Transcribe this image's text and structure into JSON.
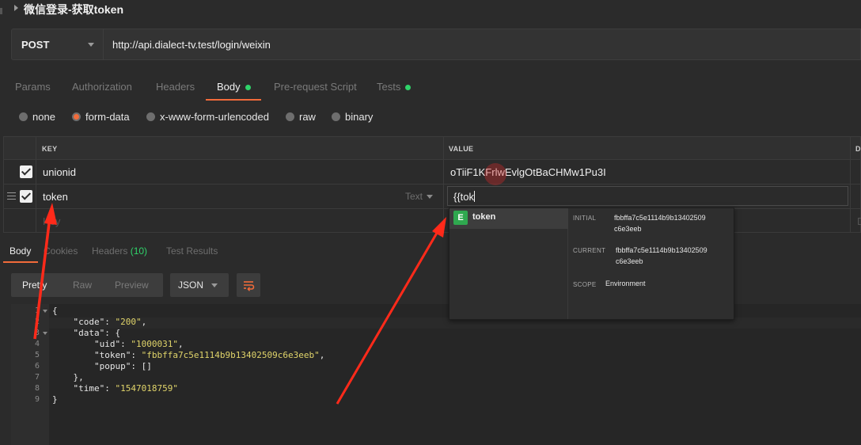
{
  "request": {
    "title": "微信登录-获取token",
    "method": "POST",
    "url": "http://api.dialect-tv.test/login/weixin"
  },
  "request_tabs": [
    {
      "label": "Params",
      "active": false
    },
    {
      "label": "Authorization",
      "active": false
    },
    {
      "label": "Headers",
      "active": false
    },
    {
      "label": "Body",
      "active": true,
      "dot": true
    },
    {
      "label": "Pre-request Script",
      "active": false
    },
    {
      "label": "Tests",
      "active": false,
      "dot": true
    }
  ],
  "body_types": [
    {
      "label": "none",
      "selected": false
    },
    {
      "label": "form-data",
      "selected": true
    },
    {
      "label": "x-www-form-urlencoded",
      "selected": false
    },
    {
      "label": "raw",
      "selected": false
    },
    {
      "label": "binary",
      "selected": false
    }
  ],
  "form_table": {
    "headers": {
      "key": "KEY",
      "value": "VALUE",
      "description": "D"
    },
    "rows": [
      {
        "checked": true,
        "key": "unionid",
        "value": "oTiiF1KFrlwEvlgOtBaCHMw1Pu3I"
      },
      {
        "checked": true,
        "key": "token",
        "type": "Text",
        "value": "{{tok"
      }
    ],
    "empty_row": {
      "key_placeholder": "Key",
      "desc_placeholder": "D"
    }
  },
  "response_tabs": [
    {
      "label": "Body",
      "active": true
    },
    {
      "label": "Cookies",
      "active": false
    },
    {
      "label": "Headers",
      "active": false,
      "count": "(10)"
    },
    {
      "label": "Test Results",
      "active": false
    }
  ],
  "view_modes": [
    "Pretty",
    "Raw",
    "Preview"
  ],
  "format": "JSON",
  "response_lines": [
    {
      "n": "1",
      "text": "{"
    },
    {
      "n": "2",
      "text": "    \"code\": \"200\","
    },
    {
      "n": "3",
      "text": "    \"data\": {"
    },
    {
      "n": "4",
      "text": "        \"uid\": \"1000031\","
    },
    {
      "n": "5",
      "text": "        \"token\": \"fbbffa7c5e1114b9b13402509c6e3eeb\","
    },
    {
      "n": "6",
      "text": "        \"popup\": []"
    },
    {
      "n": "7",
      "text": "    },"
    },
    {
      "n": "8",
      "text": "    \"time\": \"1547018759\""
    },
    {
      "n": "9",
      "text": "}"
    }
  ],
  "autocomplete": {
    "badge": "E",
    "name": "token",
    "initial_label": "INITIAL",
    "initial_value": "fbbffa7c5e1114b9b13402509c6e3eeb",
    "current_label": "CURRENT",
    "current_value": "fbbffa7c5e1114b9b13402509c6e3eeb",
    "scope_label": "SCOPE",
    "scope_value": "Environment"
  },
  "colors": {
    "accent": "#f26b3a",
    "dot": "#2fd46a",
    "env_badge": "#2fa84f",
    "annotation_arrow": "#ff2a1a"
  }
}
